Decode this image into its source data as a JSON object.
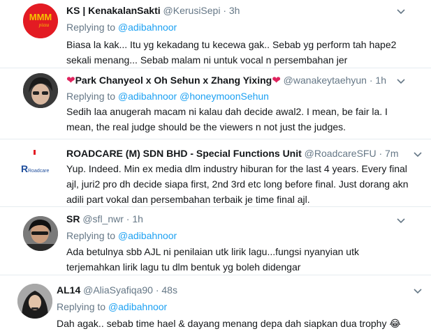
{
  "tweets": [
    {
      "name": "KS | KenakalanSakti",
      "handle": "@KerusiSepi",
      "time": "· 3h",
      "reply_prefix": "Replying to",
      "reply_to": "@adibahnoor",
      "reply_to_2": "",
      "text": "Biasa la kak... Itu yg kekadang tu kecewa gak.. Sebab yg perform tah hape2 sekali menang... Sebab malam ni untuk vocal n persembahan jer",
      "avatar": "red-logo-avatar"
    },
    {
      "name": "Park Chanyeol x Oh Sehun x Zhang Yixing",
      "handle": "@wanakeytaehyun",
      "time": "· 1h",
      "reply_prefix": "Replying to",
      "reply_to": "@adibahnoor",
      "reply_to_2": "@honeymoonSehun",
      "text": "Sedih laa anugerah macam ni kalau dah decide awal2. I mean, be fair la. I mean, the real judge should be the viewers n not just the judges.",
      "avatar": "person-photo-avatar"
    },
    {
      "name": "ROADCARE (M) SDN BHD - Special Functions Unit",
      "handle": "@RoadcareSFU",
      "time": "· 7m",
      "reply_prefix": "",
      "reply_to": "",
      "reply_to_2": "",
      "text": "Yup. Indeed. Min ex media dlm industry hiburan for the last 4 years. Every final ajl, juri2 pro dh decide siapa first, 2nd 3rd etc long before final. Just dorang akn adili part vokal dan persembahan terbaik je time final ajl.",
      "avatar": "roadcare-logo-avatar",
      "logo_text": "Roadcare"
    },
    {
      "name": "SR",
      "handle": "@sfl_nwr",
      "time": "· 1h",
      "reply_prefix": "Replying to",
      "reply_to": "@adibahnoor",
      "reply_to_2": "",
      "text": "Ada betulnya sbb AJL ni penilaian utk lirik lagu...fungsi nyanyian utk terjemahkan lirik lagu tu dlm bentuk yg boleh didengar",
      "avatar": "person-photo-avatar"
    },
    {
      "name": "AL14",
      "handle": "@AliaSyafiqa90",
      "time": "· 48s",
      "reply_prefix": "Replying to",
      "reply_to": "@adibahnoor",
      "reply_to_2": "",
      "text": "Dah agak.. sebab time hael & dayang menang depa dah siapkan dua trophy 😂",
      "avatar": "person-photo-avatar"
    }
  ],
  "colors": {
    "link": "#1da1f2",
    "muted": "#657786",
    "heart": "#e0245e"
  },
  "icons": {
    "more": "chevron-down-icon",
    "heart": "heart-icon"
  }
}
